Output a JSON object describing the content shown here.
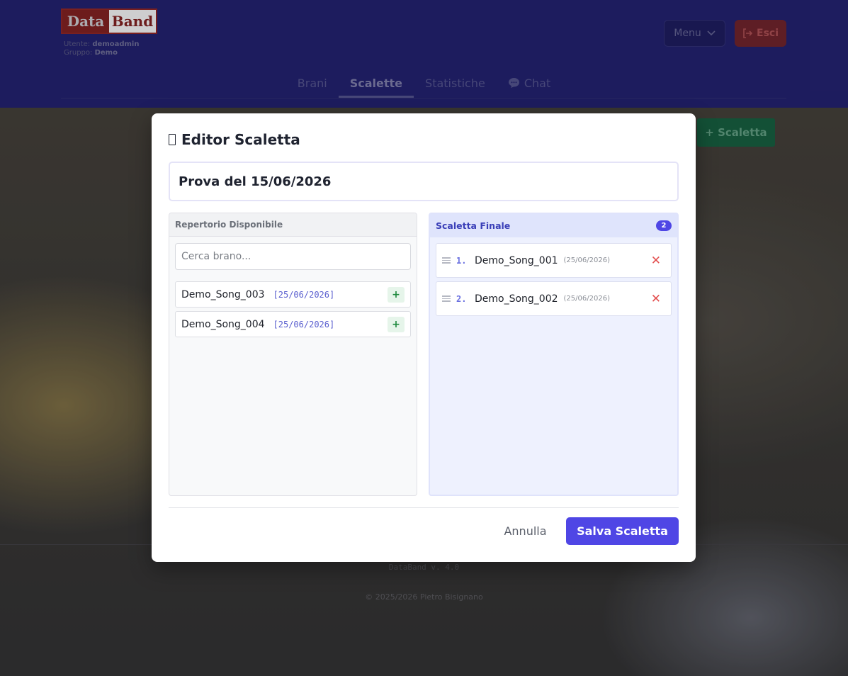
{
  "header": {
    "logo_part1": "Data",
    "logo_part2": "Band",
    "user_label": "Utente:",
    "user_value": "demoadmin",
    "group_label": "Gruppo:",
    "group_value": "Demo",
    "menu_label": "Menu",
    "exit_label": "Esci",
    "nav": [
      {
        "label": "Brani"
      },
      {
        "label": "Scalette"
      },
      {
        "label": "Statistiche"
      },
      {
        "label": "Chat"
      }
    ],
    "add_setlist_label": "+ Scaletta"
  },
  "footer": {
    "version": "DataBand v. 4.0",
    "copyright": "© 2025/2026 Pietro Bisignano"
  },
  "modal": {
    "title": "Editor Scaletta",
    "name_value": "Prova del 15/06/2026",
    "repertoire": {
      "title": "Repertorio Disponibile",
      "search_placeholder": "Cerca brano...",
      "items": [
        {
          "name": "Demo_Song_003",
          "date": "[25/06/2026]",
          "add": "+"
        },
        {
          "name": "Demo_Song_004",
          "date": "[25/06/2026]",
          "add": "+"
        }
      ]
    },
    "setlist": {
      "title": "Scaletta Finale",
      "count": "2",
      "items": [
        {
          "num": "1.",
          "name": "Demo_Song_001",
          "date": "(25/06/2026)"
        },
        {
          "num": "2.",
          "name": "Demo_Song_002",
          "date": "(25/06/2026)"
        }
      ]
    },
    "cancel_label": "Annulla",
    "save_label": "Salva Scaletta"
  },
  "colors": {
    "header_bg": "#1c1a6b",
    "accent": "#4f46e5",
    "remove": "#e35050",
    "add": "#1f8a3f"
  }
}
